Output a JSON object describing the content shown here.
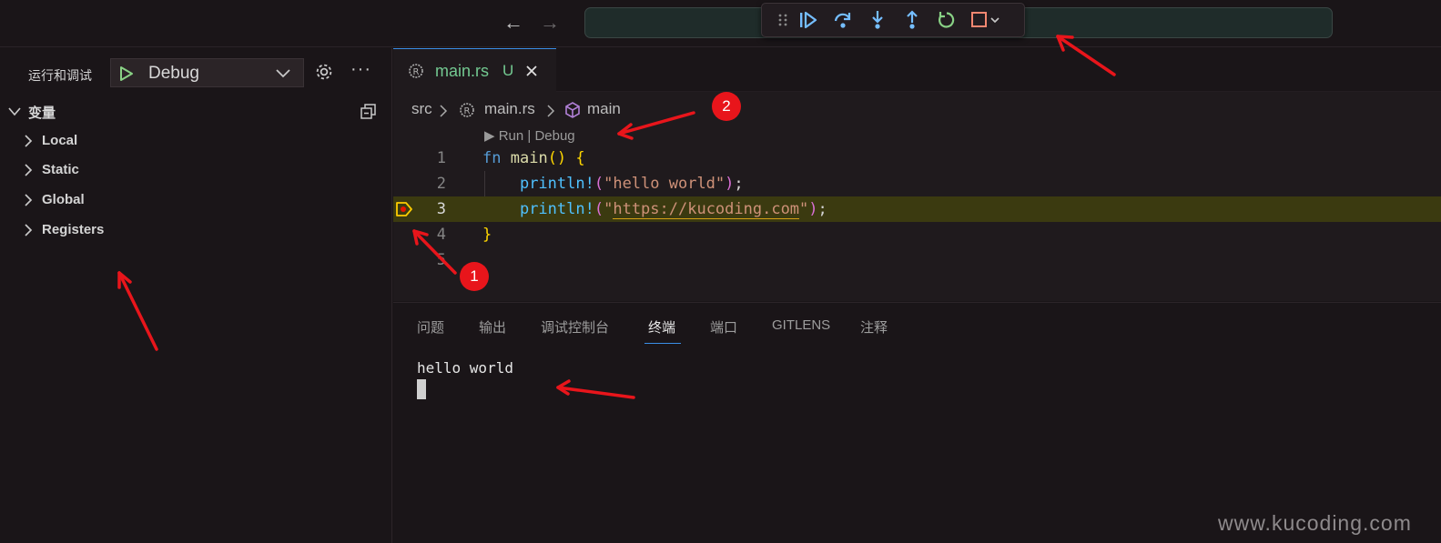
{
  "titlebar": {
    "back_arrow": "←",
    "forward_arrow": "→",
    "debug_toolbar": [
      "continue-icon",
      "step-over-icon",
      "step-into-icon",
      "step-out-icon",
      "restart-icon",
      "stop-icon"
    ]
  },
  "sidebar": {
    "title": "运行和调试",
    "config_label": "Debug",
    "more_label": "···",
    "section_title": "变量",
    "items": [
      {
        "label": "Local"
      },
      {
        "label": "Static"
      },
      {
        "label": "Global"
      },
      {
        "label": "Registers"
      }
    ]
  },
  "editor": {
    "tab": {
      "name": "main.rs",
      "badge": "U"
    },
    "breadcrumb": [
      "src",
      "main.rs",
      "main"
    ],
    "codelens": "▶ Run | Debug",
    "lines": [
      {
        "num": "1"
      },
      {
        "num": "2"
      },
      {
        "num": "3"
      },
      {
        "num": "4"
      },
      {
        "num": "5"
      }
    ],
    "code": {
      "l1_kw": "fn",
      "l1_fn": "main",
      "l1_paren": "()",
      "l1_brace": "{",
      "l2_macro": "println!",
      "l2_str": "\"hello world\"",
      "l3_macro": "println!",
      "l3_str_open": "\"",
      "l3_url": "https://kucoding.com",
      "l3_str_close": "\"",
      "l4_brace": "}",
      "semi": ";",
      "open_p": "(",
      "close_p": ")"
    }
  },
  "panel": {
    "tabs": [
      {
        "label": "问题"
      },
      {
        "label": "输出"
      },
      {
        "label": "调试控制台"
      },
      {
        "label": "终端"
      },
      {
        "label": "端口"
      },
      {
        "label": "GITLENS"
      },
      {
        "label": "注释"
      }
    ],
    "terminal_output": "hello world"
  },
  "annotations": {
    "badge1": "1",
    "badge2": "2"
  },
  "watermark": "www.kucoding.com",
  "colors": {
    "accent": "#3a8ee6",
    "active_line": "#3b3a10",
    "annotation": "#e8151b"
  }
}
